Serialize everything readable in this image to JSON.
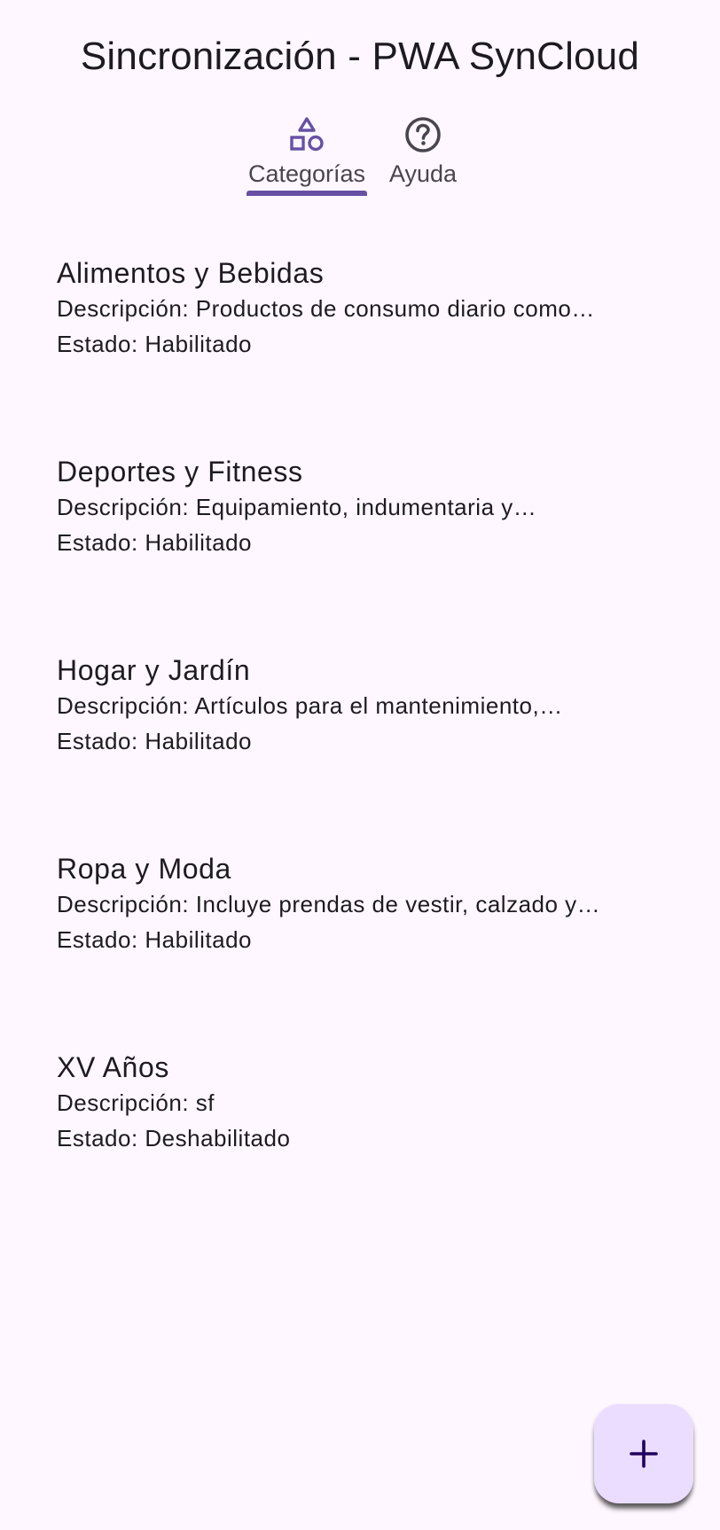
{
  "app_bar": {
    "title": "Sincronización - PWA SynCloud"
  },
  "tabs": [
    {
      "label": "Categorías",
      "icon": "shapes-icon",
      "selected": true
    },
    {
      "label": "Ayuda",
      "icon": "help-circle-icon",
      "selected": false
    }
  ],
  "categories": [
    {
      "name": "Alimentos y Bebidas",
      "description": "Descripción: Productos de consumo diario como…",
      "status": "Estado: Habilitado"
    },
    {
      "name": "Deportes y Fitness",
      "description": "Descripción: Equipamiento, indumentaria y…",
      "status": "Estado: Habilitado"
    },
    {
      "name": "Hogar y Jardín",
      "description": "Descripción: Artículos para el mantenimiento,…",
      "status": "Estado: Habilitado"
    },
    {
      "name": "Ropa y Moda",
      "description": "Descripción: Incluye prendas de vestir, calzado y…",
      "status": "Estado: Habilitado"
    },
    {
      "name": "XV Años",
      "description": "Descripción: sf",
      "status": "Estado: Deshabilitado"
    }
  ],
  "fab": {
    "icon": "plus-icon"
  },
  "colors": {
    "background": "#fef7ff",
    "primary": "#6750a4",
    "fab_container": "#eaddff",
    "fab_icon": "#21005d",
    "text": "#1d1b20",
    "secondary_text": "#49454f"
  }
}
